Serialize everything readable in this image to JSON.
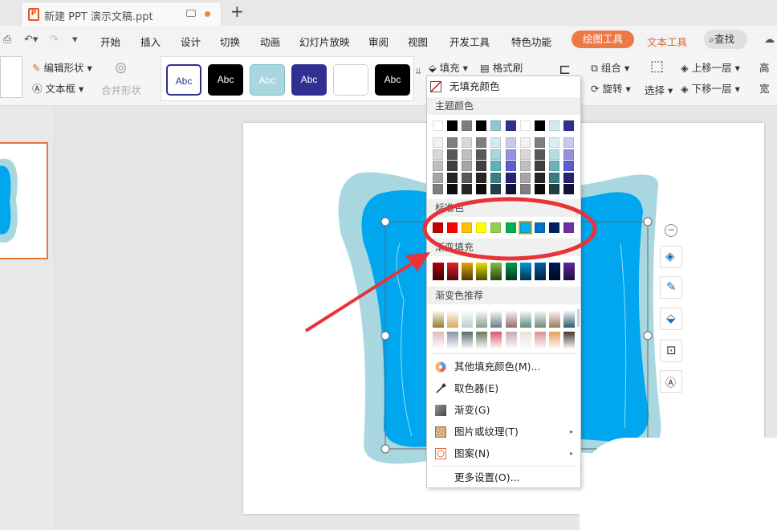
{
  "titlebar": {
    "doc_title": "新建 PPT 演示文稿.ppt",
    "tab_icon": "P",
    "new_tab_icon": "plus-icon"
  },
  "menu": {
    "items": [
      "开始",
      "插入",
      "设计",
      "切换",
      "动画",
      "幻灯片放映",
      "审阅",
      "视图",
      "开发工具",
      "特色功能"
    ],
    "active": "绘图工具",
    "text_tool": "文本工具",
    "search": "查找"
  },
  "ribbon": {
    "edit_shape": "编辑形状",
    "text_box": "文本框",
    "merge_shapes": "合并形状",
    "styles": [
      "Abc",
      "Abc",
      "Abc",
      "Abc",
      "Abc"
    ],
    "fill": "填充",
    "format_painter": "格式刷",
    "group": "组合",
    "rotate": "旋转",
    "select": "选择",
    "bring_forward": "上移一层",
    "send_backward": "下移一层",
    "edge_a": "高",
    "edge_b": "宽"
  },
  "dropdown": {
    "no_fill": "无填充颜色",
    "theme_colors_title": "主题颜色",
    "standard_colors_title": "标准色",
    "gradient_fill_title": "渐变填充",
    "gradient_recommend_title": "渐变色推荐",
    "theme_top": [
      "#ffffff",
      "#000000",
      "#7f7f7f",
      "#000000",
      "#90c8cf",
      "#303090",
      "#ffffff",
      "#000000",
      "#d4eaed",
      "#303090"
    ],
    "theme_cols": [
      [
        "#f2f2f2",
        "#d9d9d9",
        "#bfbfbf",
        "#a6a6a6",
        "#808080"
      ],
      [
        "#7f7f7f",
        "#595959",
        "#404040",
        "#262626",
        "#0d0d0d"
      ],
      [
        "#d9d9d9",
        "#bfbfbf",
        "#a6a6a6",
        "#595959",
        "#262626"
      ],
      [
        "#7f7f7f",
        "#595959",
        "#404040",
        "#262626",
        "#0d0d0d"
      ],
      [
        "#d4eaed",
        "#a9d6db",
        "#5fb0b9",
        "#3b7e85",
        "#1f4347"
      ],
      [
        "#c9c9ef",
        "#9393df",
        "#5d5dcf",
        "#242470",
        "#12123a"
      ],
      [
        "#f2f2f2",
        "#d9d9d9",
        "#bfbfbf",
        "#a6a6a6",
        "#808080"
      ],
      [
        "#7f7f7f",
        "#595959",
        "#404040",
        "#262626",
        "#0d0d0d"
      ],
      [
        "#dbeef0",
        "#b7dde1",
        "#6bb3bb",
        "#3e7b82",
        "#213f43"
      ],
      [
        "#c9c9ef",
        "#9393df",
        "#5d5dcf",
        "#242470",
        "#12123a"
      ]
    ],
    "standard": [
      "#c00000",
      "#ff0000",
      "#ffc000",
      "#ffff00",
      "#92d050",
      "#00b050",
      "#00b0f0",
      "#0070c0",
      "#002060",
      "#7030a0"
    ],
    "gradient": [
      "#b00010",
      "#e8202a",
      "#e8a800",
      "#e8e000",
      "#80c040",
      "#00a050",
      "#0098d8",
      "#0060b0",
      "#001a58",
      "#6028a0"
    ],
    "recommend_row1": [
      "#9a7a2a",
      "#d8a860",
      "#b8cdd0",
      "#8aa090",
      "#6a7a8a",
      "#9a6a6a",
      "#5a8a7a",
      "#708878",
      "#9a7a5a",
      "#2a5a70"
    ],
    "recommend_row2": [
      "#e0b8c0",
      "#8890a8",
      "#586868",
      "#687a5a",
      "#d8586a",
      "#c8a8b0",
      "#e8e0d8",
      "#d89090",
      "#e89a5a",
      "#403a30"
    ],
    "items": [
      {
        "label": "其他填充颜色(M)...",
        "icon": "palette-icon"
      },
      {
        "label": "取色器(E)",
        "icon": "eyedropper-icon"
      },
      {
        "label": "渐变(G)",
        "icon": "gradient-icon"
      },
      {
        "label": "图片或纹理(T)",
        "icon": "texture-icon",
        "submenu": true
      },
      {
        "label": "图案(N)",
        "icon": "pattern-icon",
        "submenu": true
      },
      {
        "label": "更多设置(O)...",
        "icon": ""
      }
    ]
  },
  "colors": {
    "accent": "#ec7a46",
    "highlight": "#e8333a",
    "shape_blue": "#00a6ee",
    "shape_teal": "#a8d7df"
  }
}
